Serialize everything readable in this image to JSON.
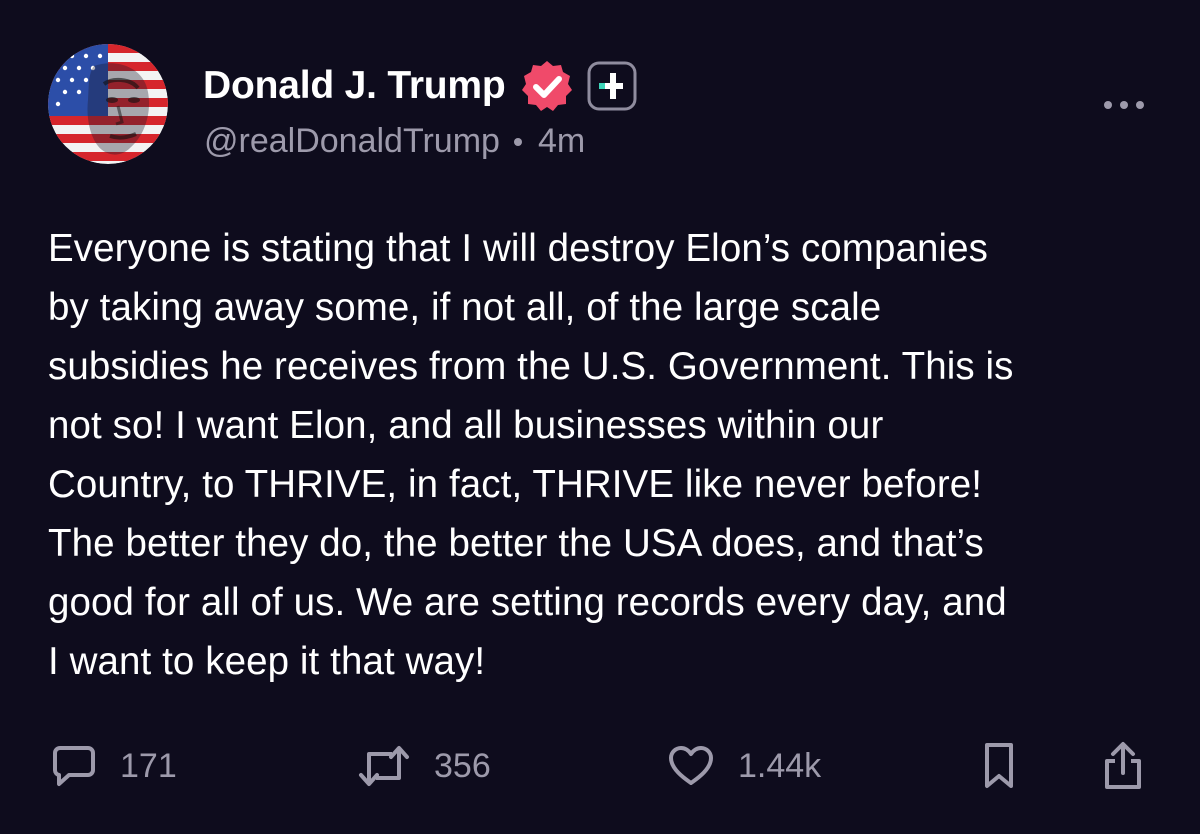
{
  "colors": {
    "background": "#0e0c1d",
    "text_primary": "#ffffff",
    "text_secondary": "#9d9aab",
    "verified_badge": "#f04a6a",
    "plus_badge_accent": "#3cd4b8"
  },
  "author": {
    "display_name": "Donald J. Trump",
    "handle": "@realDonaldTrump",
    "time_ago": "4m",
    "avatar_icon": "avatar-flag-portrait",
    "verified_icon": "verified-check-badge",
    "plus_icon": "plus-badge"
  },
  "post": {
    "text": "Everyone is stating that I will destroy Elon’s companies\nby taking away some, if not all, of the large scale\nsubsidies he receives from the U.S. Government. This is\nnot so! I want Elon, and all businesses within our\nCountry, to THRIVE, in fact, THRIVE like never before!\nThe better they do, the better the USA does, and that’s\ngood for all of us. We are setting records every day, and\nI want to keep it that way!"
  },
  "actions": {
    "replies": {
      "icon": "reply-bubble-icon",
      "count": "171"
    },
    "reposts": {
      "icon": "repost-icon",
      "count": "356"
    },
    "likes": {
      "icon": "heart-icon",
      "count": "1.44k"
    },
    "bookmark": {
      "icon": "bookmark-icon"
    },
    "share": {
      "icon": "share-icon"
    }
  },
  "menu": {
    "icon": "more-dots-icon"
  }
}
